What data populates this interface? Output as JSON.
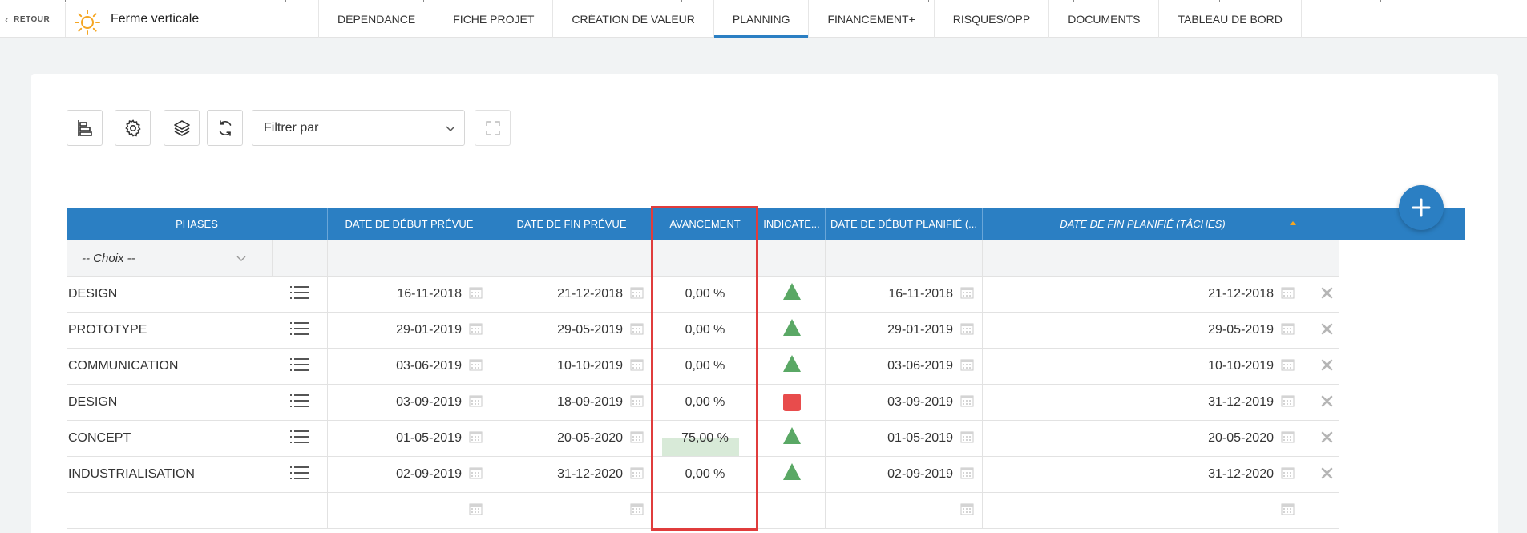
{
  "nav": {
    "back_label": "RETOUR",
    "app_title": "Ferme verticale",
    "tabs": [
      {
        "label": "DÉPENDANCE"
      },
      {
        "label": "FICHE PROJET"
      },
      {
        "label": "CRÉATION DE VALEUR"
      },
      {
        "label": "PLANNING",
        "active": true
      },
      {
        "label": "FINANCEMENT+"
      },
      {
        "label": "RISQUES/OPP"
      },
      {
        "label": "DOCUMENTS"
      },
      {
        "label": "TABLEAU DE BORD"
      }
    ]
  },
  "toolbar": {
    "filter_placeholder": "Filtrer par",
    "icons": [
      "gantt-icon",
      "gear-icon",
      "layers-icon",
      "refresh-icon",
      "expand-icon"
    ]
  },
  "table": {
    "headers": {
      "phases": "PHASES",
      "start_planned": "DATE DE DÉBUT PRÉVUE",
      "end_planned": "DATE DE FIN PRÉVUE",
      "progress": "AVANCEMENT",
      "indicator": "INDICATE...",
      "start_scheduled": "DATE DE DÉBUT PLANIFIÉ (...",
      "end_scheduled": "DATE DE FIN PLANIFIÉ (TÂCHES)"
    },
    "filter_choice": "-- Choix --",
    "rows": [
      {
        "phase": "DESIGN",
        "start": "16-11-2018",
        "end": "21-12-2018",
        "progress": "0,00 %",
        "progress_fraction": 0,
        "indicator": "triangle",
        "start_sched": "16-11-2018",
        "end_sched": "21-12-2018"
      },
      {
        "phase": "PROTOTYPE",
        "start": "29-01-2019",
        "end": "29-05-2019",
        "progress": "0,00 %",
        "progress_fraction": 0,
        "indicator": "triangle",
        "start_sched": "29-01-2019",
        "end_sched": "29-05-2019"
      },
      {
        "phase": "COMMUNICATION",
        "start": "03-06-2019",
        "end": "10-10-2019",
        "progress": "0,00 %",
        "progress_fraction": 0,
        "indicator": "triangle",
        "start_sched": "03-06-2019",
        "end_sched": "10-10-2019"
      },
      {
        "phase": "DESIGN",
        "start": "03-09-2019",
        "end": "18-09-2019",
        "progress": "0,00 %",
        "progress_fraction": 0,
        "indicator": "square",
        "start_sched": "03-09-2019",
        "end_sched": "31-12-2019"
      },
      {
        "phase": "CONCEPT",
        "start": "01-05-2019",
        "end": "20-05-2020",
        "progress": "75,00 %",
        "progress_fraction": 0.75,
        "indicator": "triangle",
        "start_sched": "01-05-2019",
        "end_sched": "20-05-2020"
      },
      {
        "phase": "INDUSTRIALISATION",
        "start": "02-09-2019",
        "end": "31-12-2020",
        "progress": "0,00 %",
        "progress_fraction": 0,
        "indicator": "triangle",
        "start_sched": "02-09-2019",
        "end_sched": "31-12-2020"
      }
    ]
  },
  "colors": {
    "accent": "#2b7fc3",
    "indicator_ok": "#5aa865",
    "indicator_alert": "#e84c4c",
    "highlight": "#e03c3c",
    "progress_fill": "#d8ead8"
  }
}
